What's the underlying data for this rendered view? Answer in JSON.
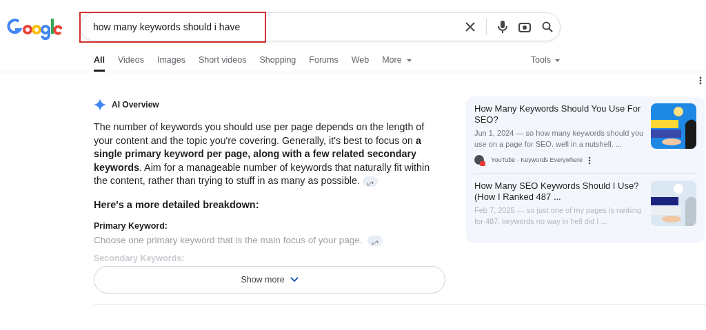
{
  "search": {
    "query": "how many keywords should i have",
    "highlighted": true
  },
  "tabs": [
    {
      "label": "All",
      "selected": true,
      "kind": "tab"
    },
    {
      "label": "Videos",
      "selected": false,
      "kind": "tab"
    },
    {
      "label": "Images",
      "selected": false,
      "kind": "tab"
    },
    {
      "label": "Short videos",
      "selected": false,
      "kind": "tab"
    },
    {
      "label": "Shopping",
      "selected": false,
      "kind": "tab"
    },
    {
      "label": "Forums",
      "selected": false,
      "kind": "tab"
    },
    {
      "label": "Web",
      "selected": false,
      "kind": "tab"
    },
    {
      "label": "More",
      "selected": false,
      "kind": "menu"
    }
  ],
  "tools": {
    "label": "Tools"
  },
  "ai_overview": {
    "title": "AI Overview",
    "summary": "The number of keywords you should use per page depends on the length of your content and the topic you're covering. Generally, it's best to focus on **a single primary keyword per page, along with a few related secondary keywords**. Aim for a manageable number of keywords that naturally fit within the content, rather than trying to stuff in as many as possible.",
    "breakdown_heading": "Here's a more detailed breakdown:",
    "points": [
      {
        "title": "Primary Keyword:",
        "text": "Choose one primary keyword that is the main focus of your page."
      },
      {
        "title": "Secondary Keywords:"
      }
    ],
    "show_more": "Show more"
  },
  "sources": [
    {
      "title": "How Many Keywords Should You Use For SEO?",
      "snippet": "Jun 1, 2024 — so how many keywords should you use on a page for SEO. well in a nutshell. ...",
      "source": "YouTube · Keywords Everywhere",
      "kind": "picture"
    },
    {
      "title": "How Many SEO Keywords Should I Use? (How I Ranked 487 ...",
      "snippet": "Feb 7, 2025 — so just one of my pages is ranking for 487. keywords no way in hell did I ...",
      "kind": "picture"
    }
  ]
}
